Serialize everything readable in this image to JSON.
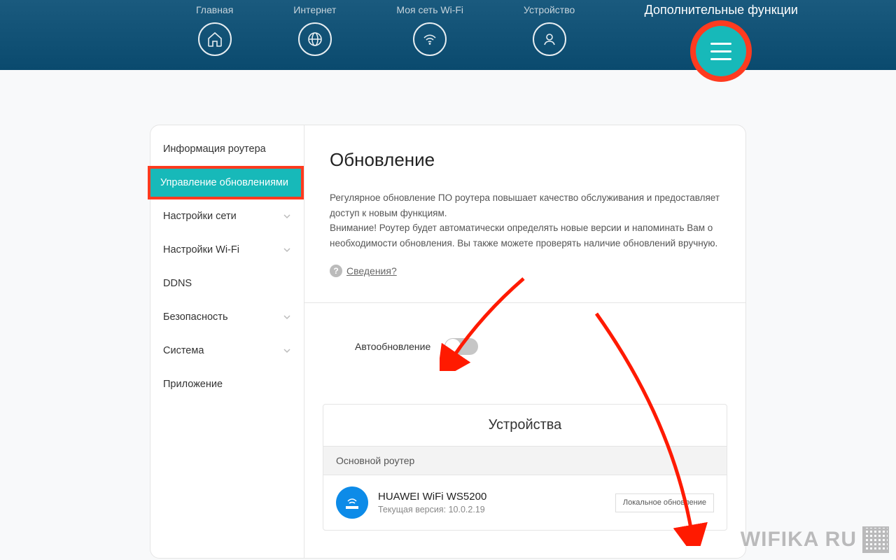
{
  "nav": {
    "home": "Главная",
    "internet": "Интернет",
    "wifi": "Моя сеть Wi-Fi",
    "device": "Устройство",
    "extra": "Дополнительные функции"
  },
  "sidebar": {
    "router_info": "Информация роутера",
    "updates": "Управление обновлениями",
    "network": "Настройки сети",
    "wifi": "Настройки Wi-Fi",
    "ddns": "DDNS",
    "security": "Безопасность",
    "system": "Система",
    "app": "Приложение"
  },
  "page": {
    "title": "Обновление",
    "desc1": "Регулярное обновление ПО роутера повышает качество обслуживания и предоставляет доступ к новым функциям.",
    "desc2": "Внимание! Роутер будет автоматически определять новые версии и напоминать Вам о необходимости обновления. Вы также можете проверять наличие обновлений вручную.",
    "details": "Сведения?",
    "auto_label": "Автообновление"
  },
  "devices": {
    "title": "Устройства",
    "segment": "Основной роутер",
    "name": "HUAWEI WiFi WS5200",
    "version_label": "Текущая версия:",
    "version": "10.0.2.19",
    "local_update": "Локальное обновление"
  },
  "watermark": "WIFIKA RU"
}
